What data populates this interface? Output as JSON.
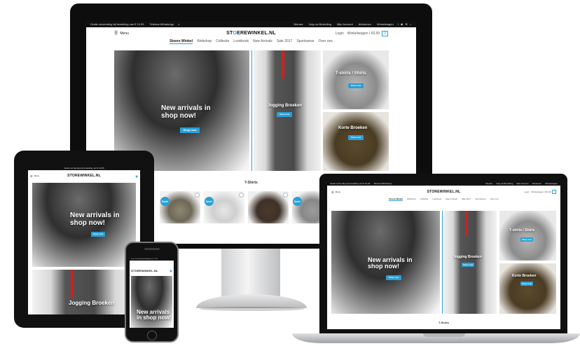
{
  "site": {
    "logo_pre": "ST",
    "logo_accent": "O",
    "logo_post": "EREWINKEL.NL",
    "logo_short": "STOREWINKEL.NL",
    "topbar_promo": "Gratis verzending bij bestelling van € 10,95",
    "topbar_phone": "Telefoon/WhatsApp",
    "topbar_links": [
      "Nieuws",
      "Volg uw Bestelling",
      "Mijn Account",
      "Afrekenen",
      "Winkelwagen"
    ],
    "menu_label": "Menu",
    "login": "Login",
    "cart": "Winkelwagen / €0,00",
    "cart_count": "0",
    "nav": [
      "Stoere Winkel",
      "Webshop",
      "Collectie",
      "Lookbook",
      "New Arrivals",
      "Sale 2017",
      "Sportswear",
      "Over ons"
    ],
    "hero_caption": "New arrivals in shop now!",
    "hero_button": "Shop now",
    "jogging_caption": "Jogging Broeken",
    "tshirt_caption": "T-shirts / Shirts",
    "shorts_caption": "Korte Broeken",
    "shop_button": "Shop now",
    "section_title": "T-Shirts",
    "sale_badge": "Sale!"
  },
  "colors": {
    "accent": "#2a9fd6",
    "topbar": "#111111",
    "bezel": "#0d0d0d"
  },
  "icons": [
    "search-icon",
    "heart-icon",
    "cart-icon",
    "menu-icon",
    "social-icon"
  ]
}
